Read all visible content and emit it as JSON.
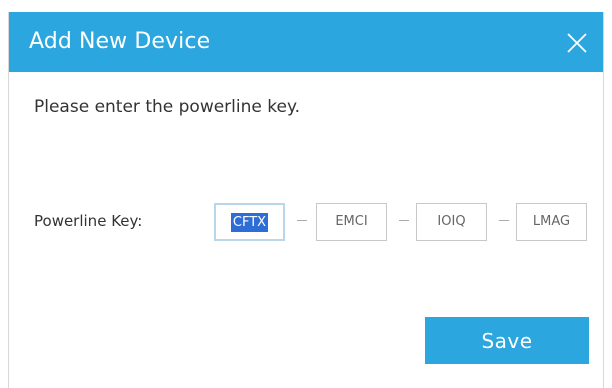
{
  "dialog": {
    "title": "Add New Device",
    "close_icon": "close-icon",
    "prompt": "Please enter the powerline key.",
    "key_label": "Powerline Key:",
    "key_segments": [
      "CFTX",
      "EMCI",
      "IOIQ",
      "LMAG"
    ],
    "save_label": "Save"
  },
  "colors": {
    "header": "#2ba6de",
    "button": "#2ba6de",
    "selection": "#2f6dd6"
  }
}
